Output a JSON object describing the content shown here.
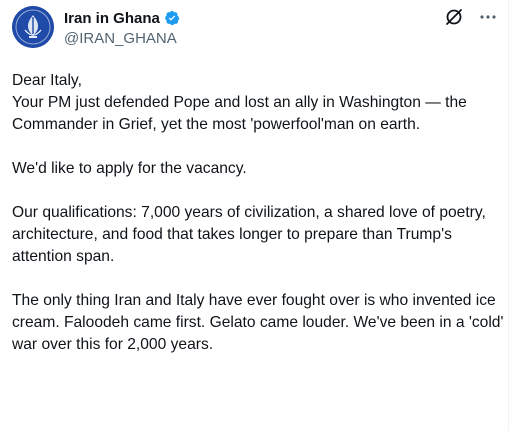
{
  "account": {
    "display_name": "Iran in Ghana",
    "handle": "@IRAN_GHANA",
    "verified": true,
    "verified_badge_color": "#1d9bf0"
  },
  "header_actions": {
    "grok_icon": "grok-icon",
    "more_icon": "more-options-icon"
  },
  "tweet": {
    "paragraphs": [
      {
        "lines": [
          "Dear Italy,",
          "Your PM just defended Pope and lost an ally in Washington — the",
          "Commander in Grief, yet the most 'powerfool'man on earth."
        ]
      },
      {
        "lines": [
          "We'd like to apply for the vacancy."
        ]
      },
      {
        "lines": [
          "Our qualifications: 7,000 years of civilization, a shared love of poetry,",
          "architecture, and food that takes longer to prepare than Trump's",
          "attention span."
        ]
      },
      {
        "lines": [
          "The only thing Iran and Italy have ever fought over is who invented ice",
          "cream. Faloodeh came first. Gelato came louder. We've been in a 'cold'",
          "war over this for 2,000 years."
        ]
      }
    ]
  },
  "colors": {
    "text_primary": "#0f1419",
    "text_secondary": "#536471",
    "avatar_bg": "#1f4aa8"
  }
}
